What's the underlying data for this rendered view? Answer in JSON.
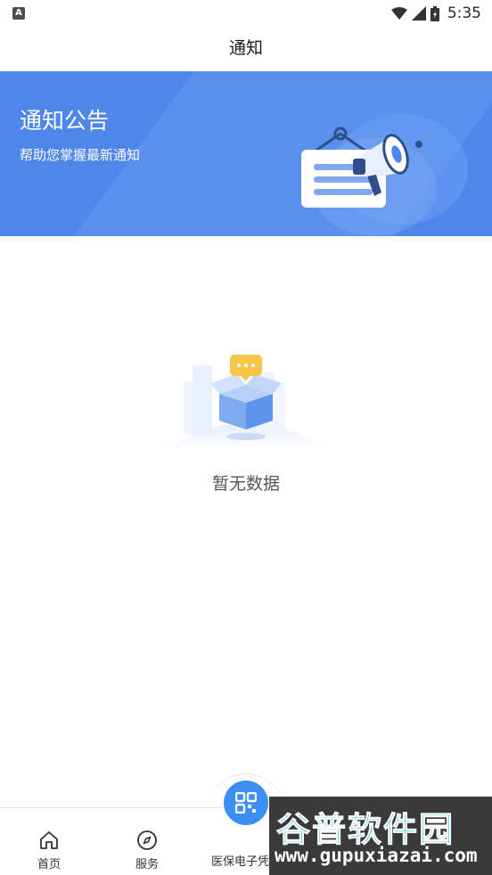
{
  "status_bar": {
    "time": "5:35",
    "app_icon_letter": "A"
  },
  "nav": {
    "title": "通知"
  },
  "banner": {
    "title": "通知公告",
    "subtitle": "帮助您掌握最新通知",
    "bg_color": "#4f86ea",
    "icon": "megaphone-notice-illustration"
  },
  "empty_state": {
    "text": "暂无数据",
    "icon": "empty-box-illustration"
  },
  "tabbar": {
    "items": [
      {
        "label": "首页",
        "icon": "home-icon"
      },
      {
        "label": "服务",
        "icon": "compass-icon"
      },
      {
        "label": "医保电子凭证",
        "icon": "qr-code-icon"
      }
    ],
    "center_color": "#3c8ff2"
  },
  "watermark": {
    "title": "谷普软件园",
    "url": "www.gupuxiazai.com"
  }
}
